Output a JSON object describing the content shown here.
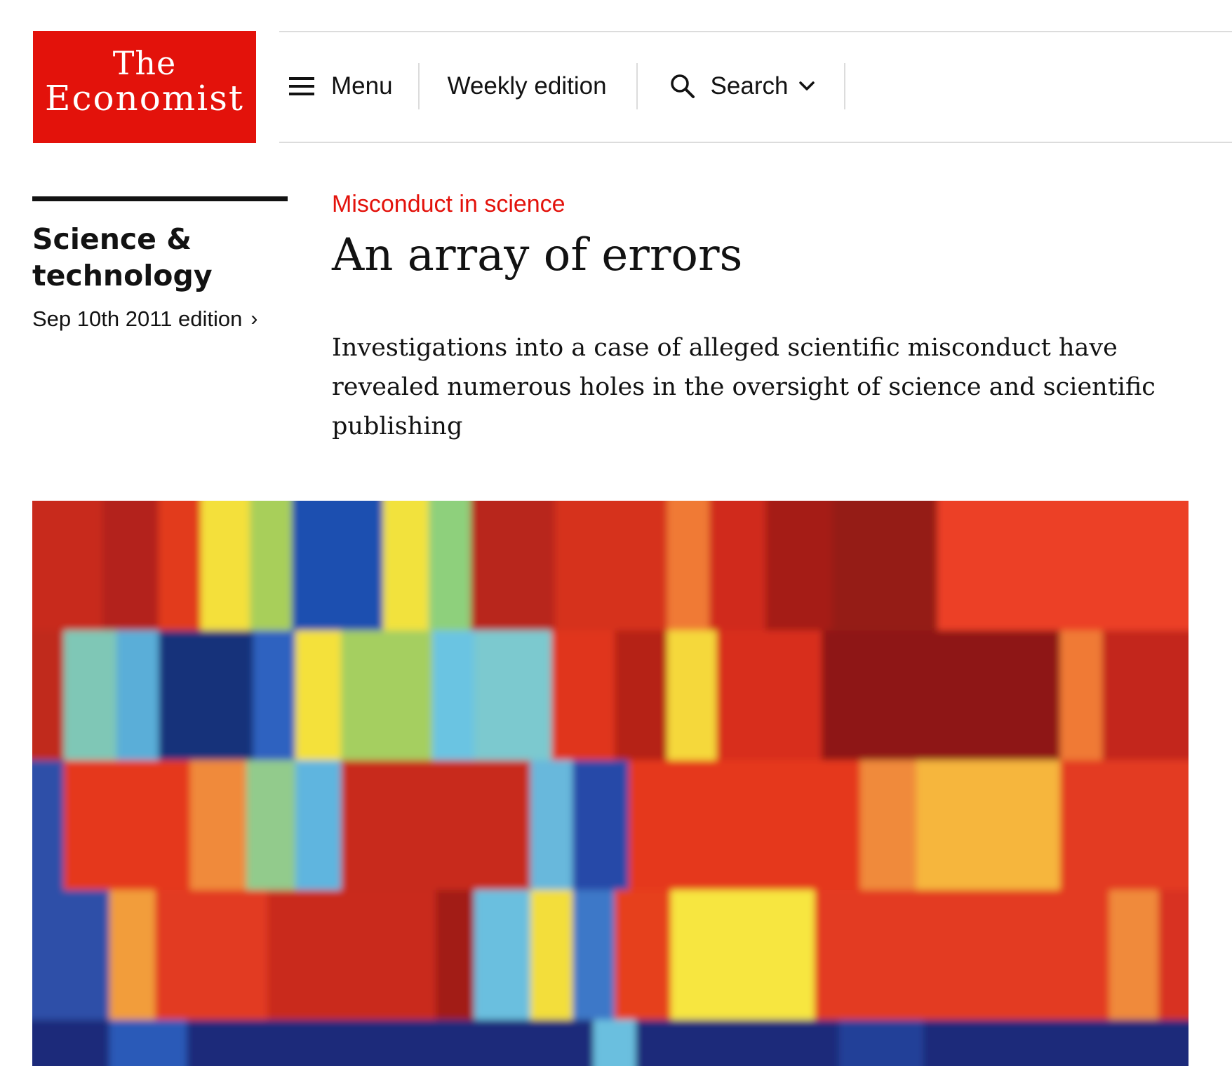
{
  "brand": {
    "logo_line1": "The",
    "logo_line2": "Economist",
    "color": "#e3120b"
  },
  "nav": {
    "menu_label": "Menu",
    "menu_icon": "hamburger-icon",
    "weekly_label": "Weekly edition",
    "search_label": "Search",
    "search_icon": "search-icon",
    "search_chevron_icon": "chevron-down-icon"
  },
  "section": {
    "title_line1": "Science &",
    "title_line2": "technology",
    "edition_label": "Sep 10th 2011 edition",
    "edition_arrow": "›"
  },
  "article": {
    "flytitle": "Misconduct in science",
    "headline": "An array of errors",
    "rubric": "Investigations into a case of alleged scientific misconduct have revealed numerous holes in the oversight of science and scientific publishing",
    "accent_color": "#e3120b"
  },
  "hero_image": {
    "subject": "heatmap-style microarray image",
    "icon": "image"
  }
}
